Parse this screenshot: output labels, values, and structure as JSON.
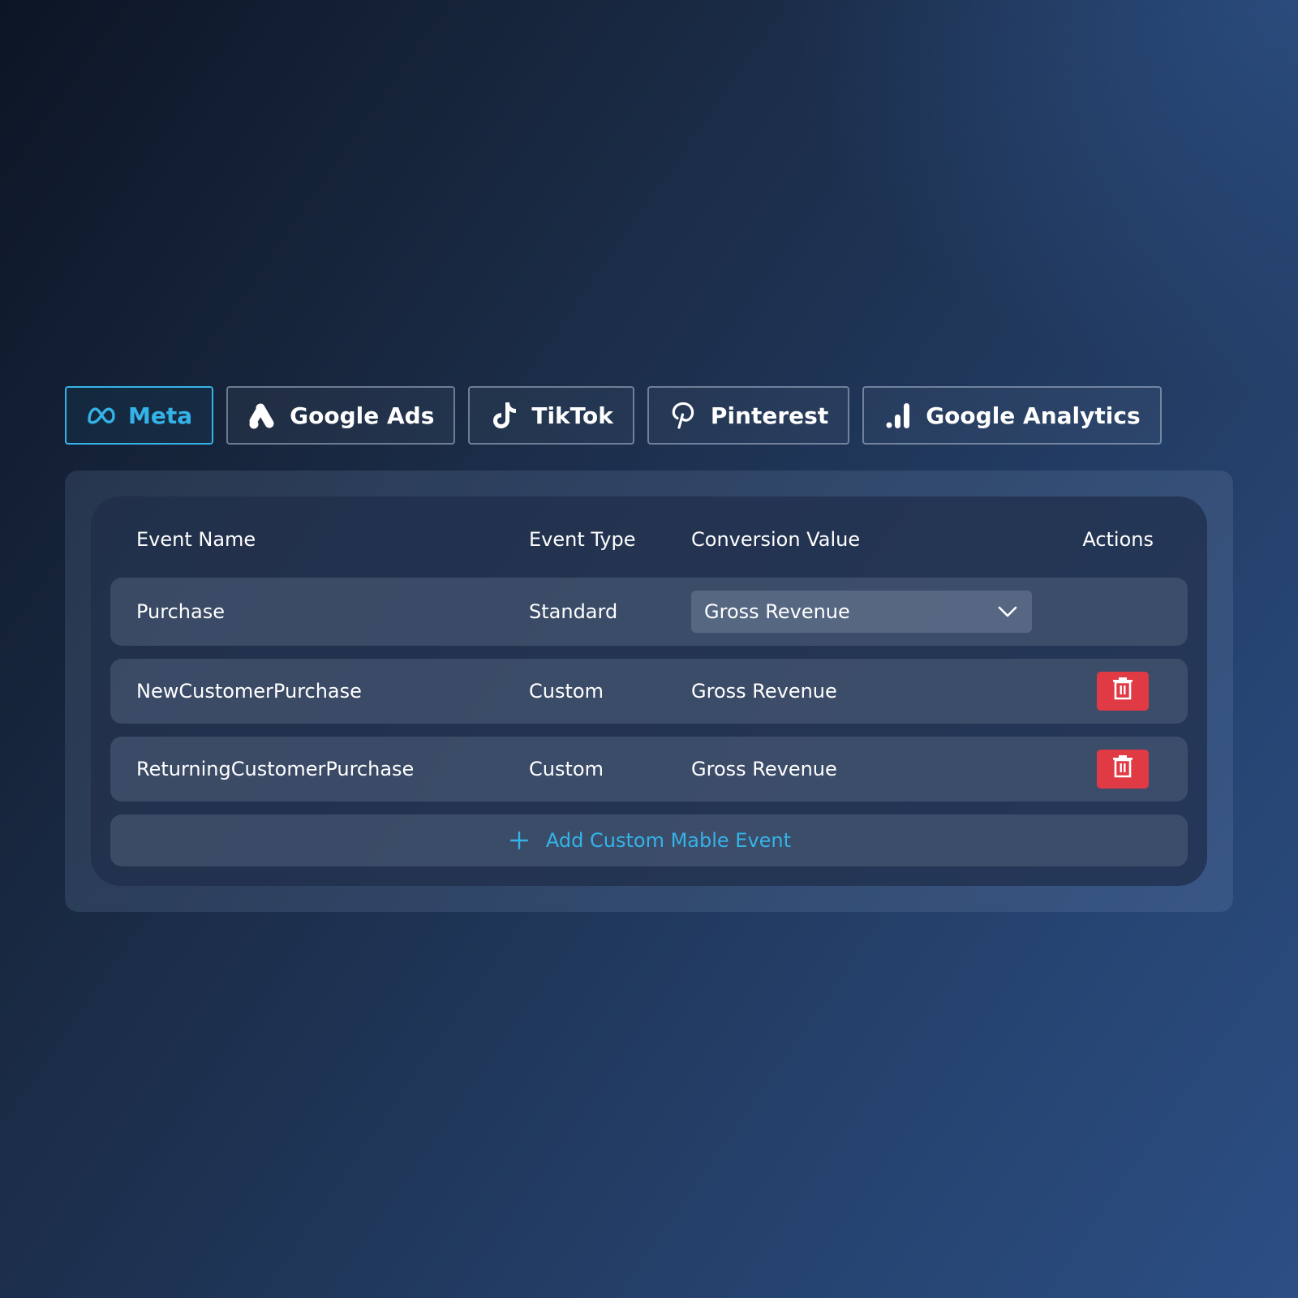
{
  "tabs": [
    {
      "label": "Meta",
      "icon": "meta-icon",
      "active": true
    },
    {
      "label": "Google Ads",
      "icon": "google-ads-icon",
      "active": false
    },
    {
      "label": "TikTok",
      "icon": "tiktok-icon",
      "active": false
    },
    {
      "label": "Pinterest",
      "icon": "pinterest-icon",
      "active": false
    },
    {
      "label": "Google Analytics",
      "icon": "google-analytics-icon",
      "active": false
    }
  ],
  "table": {
    "headers": {
      "event_name": "Event Name",
      "event_type": "Event Type",
      "conversion_value": "Conversion Value",
      "actions": "Actions"
    },
    "rows": [
      {
        "event_name": "Purchase",
        "event_type": "Standard",
        "conversion_value": "Gross Revenue",
        "editable": true,
        "deletable": false
      },
      {
        "event_name": "NewCustomerPurchase",
        "event_type": "Custom",
        "conversion_value": "Gross Revenue",
        "editable": false,
        "deletable": true
      },
      {
        "event_name": "ReturningCustomerPurchase",
        "event_type": "Custom",
        "conversion_value": "Gross Revenue",
        "editable": false,
        "deletable": true
      }
    ],
    "add_label": "Add Custom Mable Event"
  },
  "colors": {
    "accent": "#35b3e8",
    "delete": "#e03a45",
    "text": "#ffffff"
  }
}
